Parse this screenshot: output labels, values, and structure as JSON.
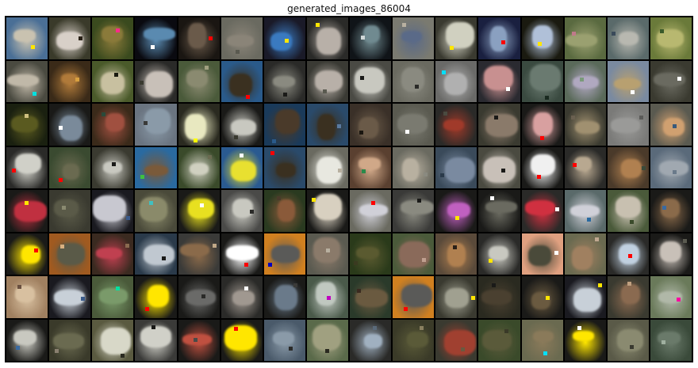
{
  "title": "generated_images_86004",
  "grid": {
    "rows": 8,
    "cols": 16
  },
  "tiles": [
    {
      "bg": "#4a6f96",
      "fg": "#c9c2b0",
      "accent": "#ffe600"
    },
    {
      "bg": "#3a3a2a",
      "fg": "#d8d0c8",
      "accent": "#2a2218"
    },
    {
      "bg": "#3a4a1e",
      "fg": "#8a7a3a",
      "accent": "#ff2a8a"
    },
    {
      "bg": "#0a0a10",
      "fg": "#5a8ab0",
      "accent": "#ffffff"
    },
    {
      "bg": "#1a1612",
      "fg": "#6a5a4a",
      "accent": "#ff0000"
    },
    {
      "bg": "#6a6a60",
      "fg": "#8a8478",
      "accent": "#5a5a50"
    },
    {
      "bg": "#1a1a28",
      "fg": "#3a7ac0",
      "accent": "#ffe600"
    },
    {
      "bg": "#2a2a28",
      "fg": "#b8b0a8",
      "accent": "#ffe600"
    },
    {
      "bg": "#101418",
      "fg": "#708a90",
      "accent": "#d0d8d8"
    },
    {
      "bg": "#7a7a70",
      "fg": "#5a6a88",
      "accent": "#b8b0a0"
    },
    {
      "bg": "#3a3a30",
      "fg": "#d0d0c0",
      "accent": "#ffe600"
    },
    {
      "bg": "#1a2040",
      "fg": "#8aa0c0",
      "accent": "#ff0000"
    },
    {
      "bg": "#1a1a10",
      "fg": "#b0c0d8",
      "accent": "#ffe600"
    },
    {
      "bg": "#5a6a40",
      "fg": "#9aa070",
      "accent": "#c07a8a"
    },
    {
      "bg": "#5a6a6a",
      "fg": "#b8b8b0",
      "accent": "#3a4a5a"
    },
    {
      "bg": "#6a7a3a",
      "fg": "#b8b870",
      "accent": "#3a5a2a"
    },
    {
      "bg": "#4a4a40",
      "fg": "#c0b8a8",
      "accent": "#00e0e0"
    },
    {
      "bg": "#3a2a18",
      "fg": "#b07a3a",
      "accent": "#d8a040"
    },
    {
      "bg": "#4a5a2a",
      "fg": "#c8c0a0",
      "accent": "#1a1a10"
    },
    {
      "bg": "#2a2a28",
      "fg": "#c8c0b8",
      "accent": "#3a3a30"
    },
    {
      "bg": "#4a5a3a",
      "fg": "#8a8a70",
      "accent": "#a0a080"
    },
    {
      "bg": "#2a5a8a",
      "fg": "#3a3020",
      "accent": "#ff0000"
    },
    {
      "bg": "#2a2a28",
      "fg": "#8a8a80",
      "accent": "#1a1a18"
    },
    {
      "bg": "#3a3a34",
      "fg": "#b8b0a8",
      "accent": "#5a5a50"
    },
    {
      "bg": "#4a4a44",
      "fg": "#c8c8c0",
      "accent": "#1a1a18"
    },
    {
      "bg": "#6a6a60",
      "fg": "#8a8a80",
      "accent": "#2a2a28"
    },
    {
      "bg": "#6a6a68",
      "fg": "#b0b0b0",
      "accent": "#00e0ff"
    },
    {
      "bg": "#2a2a30",
      "fg": "#c89090",
      "accent": "#ffffff"
    },
    {
      "bg": "#3a4a40",
      "fg": "#6a7a70",
      "accent": "#1a2a20"
    },
    {
      "bg": "#5a6a5a",
      "fg": "#b0a8c0",
      "accent": "#7a9a7a"
    },
    {
      "bg": "#7a8aa0",
      "fg": "#b8a070",
      "accent": "#ffffff"
    },
    {
      "bg": "#3a3a30",
      "fg": "#6a6a60",
      "accent": "#ffffff"
    },
    {
      "bg": "#1a2010",
      "fg": "#5a5a20",
      "accent": "#d0c080"
    },
    {
      "bg": "#1a1a18",
      "fg": "#7a8a9a",
      "accent": "#ffffff"
    },
    {
      "bg": "#3a2a1a",
      "fg": "#a05040",
      "accent": "#2a4a3a"
    },
    {
      "bg": "#6a7480",
      "fg": "#8a9aa8",
      "accent": "#3a3a38"
    },
    {
      "bg": "#2a2a20",
      "fg": "#e8e8c0",
      "accent": "#ffff00"
    },
    {
      "bg": "#1a1a18",
      "fg": "#c8c8c0",
      "accent": "#3a3a30"
    },
    {
      "bg": "#1a3a5a",
      "fg": "#4a3a2a",
      "accent": "#2a5a8a"
    },
    {
      "bg": "#2a4a6a",
      "fg": "#3a3020",
      "accent": "#5a7aa0"
    },
    {
      "bg": "#3a3028",
      "fg": "#6a5a48",
      "accent": "#1a1610"
    },
    {
      "bg": "#5a5a50",
      "fg": "#7a7a70",
      "accent": "#ffffff"
    },
    {
      "bg": "#2a2a28",
      "fg": "#a03a2a",
      "accent": "#4a4a40"
    },
    {
      "bg": "#3a3a30",
      "fg": "#8a7a6a",
      "accent": "#1a1a18"
    },
    {
      "bg": "#1a1a18",
      "fg": "#d8a0a0",
      "accent": "#ff0000"
    },
    {
      "bg": "#3a3a30",
      "fg": "#a09070",
      "accent": "#6a6050"
    },
    {
      "bg": "#7a7a78",
      "fg": "#9a9a98",
      "accent": "#5a5a58"
    },
    {
      "bg": "#5a5a50",
      "fg": "#d0a070",
      "accent": "#3a5a7a"
    },
    {
      "bg": "#2a2a28",
      "fg": "#d0d0c8",
      "accent": "#ff0000"
    },
    {
      "bg": "#3a4a30",
      "fg": "#6a6a50",
      "accent": "#ff0000"
    },
    {
      "bg": "#3a3a30",
      "fg": "#c8c8c0",
      "accent": "#1a1a18"
    },
    {
      "bg": "#2a6aa0",
      "fg": "#7a5a3a",
      "accent": "#40c040"
    },
    {
      "bg": "#3a4a2a",
      "fg": "#d0d0c0",
      "accent": "#6a6a50"
    },
    {
      "bg": "#2a5a90",
      "fg": "#e8e030",
      "accent": "#ffffff"
    },
    {
      "bg": "#2a4a6a",
      "fg": "#3a3020",
      "accent": "#ff0000"
    },
    {
      "bg": "#6a6a60",
      "fg": "#e8e8e0",
      "accent": "#b8b0a0"
    },
    {
      "bg": "#5a4030",
      "fg": "#d0a888",
      "accent": "#2a8a4a"
    },
    {
      "bg": "#6a6a60",
      "fg": "#b8b0a0",
      "accent": "#8a8a80"
    },
    {
      "bg": "#3a4a5a",
      "fg": "#7a8aa0",
      "accent": "#2a3a4a"
    },
    {
      "bg": "#4a4a40",
      "fg": "#c8c0b8",
      "accent": "#1a1a18"
    },
    {
      "bg": "#1a1a18",
      "fg": "#f0f0f0",
      "accent": "#ff0000"
    },
    {
      "bg": "#2a2a28",
      "fg": "#b8a890",
      "accent": "#ff0000"
    },
    {
      "bg": "#4a3a2a",
      "fg": "#b08050",
      "accent": "#3a4a3a"
    },
    {
      "bg": "#5a6a7a",
      "fg": "#a0a8b0",
      "accent": "#6a7a8a"
    },
    {
      "bg": "#1a1a18",
      "fg": "#c03040",
      "accent": "#ffe600"
    },
    {
      "bg": "#3a3a30",
      "fg": "#5a5a48",
      "accent": "#8a8a70"
    },
    {
      "bg": "#1a1a20",
      "fg": "#c8c8d0",
      "accent": "#3a5a8a"
    },
    {
      "bg": "#4a4a3a",
      "fg": "#8a8a6a",
      "accent": "#40c0c0"
    },
    {
      "bg": "#1a1a18",
      "fg": "#e8e020",
      "accent": "#ffffff"
    },
    {
      "bg": "#4a4a48",
      "fg": "#c8c8c0",
      "accent": "#2a2a28"
    },
    {
      "bg": "#2a3a20",
      "fg": "#8a5a3a",
      "accent": "#4a3a2a"
    },
    {
      "bg": "#1a1a18",
      "fg": "#d8d0c0",
      "accent": "#ffe600"
    },
    {
      "bg": "#6a6a60",
      "fg": "#d0d0d8",
      "accent": "#ff0000"
    },
    {
      "bg": "#3a3a38",
      "fg": "#8a8a80",
      "accent": "#1a1a18"
    },
    {
      "bg": "#1a1a18",
      "fg": "#c060c0",
      "accent": "#ffe600"
    },
    {
      "bg": "#1a1a18",
      "fg": "#6a6a60",
      "accent": "#ffffff"
    },
    {
      "bg": "#2a2a28",
      "fg": "#d03040",
      "accent": "#ffffff"
    },
    {
      "bg": "#5a6a6a",
      "fg": "#d0d0d8",
      "accent": "#2a6aa0"
    },
    {
      "bg": "#4a5a3a",
      "fg": "#c8c0b0",
      "accent": "#3a4a2a"
    },
    {
      "bg": "#1a1a18",
      "fg": "#8a6a4a",
      "accent": "#3a6aa0"
    },
    {
      "bg": "#1a1a18",
      "fg": "#ffe600",
      "accent": "#ff0000"
    },
    {
      "bg": "#a05a20",
      "fg": "#5a5a48",
      "accent": "#d8b080"
    },
    {
      "bg": "#3a2a20",
      "fg": "#c04050",
      "accent": "#8a6a50"
    },
    {
      "bg": "#2a3a4a",
      "fg": "#c0c8d0",
      "accent": "#1a1a18"
    },
    {
      "bg": "#3a3a38",
      "fg": "#8a6a4a",
      "accent": "#c0a888"
    },
    {
      "bg": "#1a1a18",
      "fg": "#ffffff",
      "accent": "#ff0000"
    },
    {
      "bg": "#d08020",
      "fg": "#5a5a58",
      "accent": "#0000c0"
    },
    {
      "bg": "#5a5a50",
      "fg": "#8a7a6a",
      "accent": "#b8b0a0"
    },
    {
      "bg": "#2a3a1a",
      "fg": "#5a5a30",
      "accent": "#3a3a20"
    },
    {
      "bg": "#4a5a3a",
      "fg": "#8a6a5a",
      "accent": "#c0a090"
    },
    {
      "bg": "#5a4a3a",
      "fg": "#b08050",
      "accent": "#2a2018"
    },
    {
      "bg": "#2a2a28",
      "fg": "#c8c8c0",
      "accent": "#ffe600"
    },
    {
      "bg": "#e0a080",
      "fg": "#4a4a3a",
      "accent": "#ffffff"
    },
    {
      "bg": "#6a6a50",
      "fg": "#a08060",
      "accent": "#c0a890"
    },
    {
      "bg": "#2a2a28",
      "fg": "#c0d0e0",
      "accent": "#ff0000"
    },
    {
      "bg": "#1a1a18",
      "fg": "#c8c0b8",
      "accent": "#5a5a50"
    },
    {
      "bg": "#a08060",
      "fg": "#d8c0a0",
      "accent": "#6a5040"
    },
    {
      "bg": "#1a1a20",
      "fg": "#c8d0d8",
      "accent": "#3a5a8a"
    },
    {
      "bg": "#4a5a3a",
      "fg": "#7a9a6a",
      "accent": "#00e0a0"
    },
    {
      "bg": "#1a1a18",
      "fg": "#ffe600",
      "accent": "#ff0000"
    },
    {
      "bg": "#1a1a18",
      "fg": "#6a6a68",
      "accent": "#2a2a28"
    },
    {
      "bg": "#2a2a28",
      "fg": "#a09890",
      "accent": "#ffffff"
    },
    {
      "bg": "#1a1a18",
      "fg": "#6a7a8a",
      "accent": "#3a3a38"
    },
    {
      "bg": "#4a5a4a",
      "fg": "#c0c8c0",
      "accent": "#c000c0"
    },
    {
      "bg": "#2a3a2a",
      "fg": "#6a5a40",
      "accent": "#3a2a20"
    },
    {
      "bg": "#d08020",
      "fg": "#5a5a58",
      "accent": "#ff0000"
    },
    {
      "bg": "#3a3a30",
      "fg": "#a0a090",
      "accent": "#ffe600"
    },
    {
      "bg": "#2a2a20",
      "fg": "#4a4030",
      "accent": "#1a1a18"
    },
    {
      "bg": "#1a1a18",
      "fg": "#6a5a40",
      "accent": "#ffe600"
    },
    {
      "bg": "#1a1a20",
      "fg": "#c8d0d8",
      "accent": "#ffe600"
    },
    {
      "bg": "#3a3a30",
      "fg": "#8a6a50",
      "accent": "#c0a080"
    },
    {
      "bg": "#6a7a5a",
      "fg": "#b0b8a8",
      "accent": "#ff00a0"
    },
    {
      "bg": "#1a1a18",
      "fg": "#c8c8c0",
      "accent": "#3a6aa0"
    },
    {
      "bg": "#3a3a2a",
      "fg": "#6a6a50",
      "accent": "#8a8070"
    },
    {
      "bg": "#5a5a40",
      "fg": "#d8d8c8",
      "accent": "#2a2a20"
    },
    {
      "bg": "#3a3a38",
      "fg": "#d0d0c8",
      "accent": "#1a1a18"
    },
    {
      "bg": "#1a1a18",
      "fg": "#c05040",
      "accent": "#4a4a48"
    },
    {
      "bg": "#1a1a18",
      "fg": "#ffe600",
      "accent": "#ff0000"
    },
    {
      "bg": "#4a5a6a",
      "fg": "#8a9aa8",
      "accent": "#2a2a28"
    },
    {
      "bg": "#5a6a4a",
      "fg": "#a0a080",
      "accent": "#2a2a20"
    },
    {
      "bg": "#2a2a28",
      "fg": "#a0b0c0",
      "accent": "#5a6a7a"
    },
    {
      "bg": "#3a3a28",
      "fg": "#5a5a38",
      "accent": "#8a8060"
    },
    {
      "bg": "#3a3a30",
      "fg": "#a04030",
      "accent": "#6a5a40"
    },
    {
      "bg": "#3a4a2a",
      "fg": "#5a5a3a",
      "accent": "#3a3a28"
    },
    {
      "bg": "#6a6a50",
      "fg": "#8a7a5a",
      "accent": "#00e0ff"
    },
    {
      "bg": "#1a1a18",
      "fg": "#ffe600",
      "accent": "#ffffff"
    },
    {
      "bg": "#5a5a48",
      "fg": "#8a8a70",
      "accent": "#3a3a30"
    },
    {
      "bg": "#3a4a3a",
      "fg": "#6a7a6a",
      "accent": "#a0b0a0"
    }
  ]
}
